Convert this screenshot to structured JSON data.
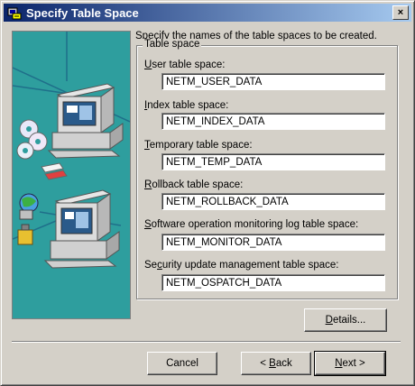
{
  "window": {
    "title": "Specify Table Space",
    "close_glyph": "×"
  },
  "intro": "Specify the names of the table spaces to be created.",
  "group": {
    "label": "Table space"
  },
  "fields": [
    {
      "label_pre": "",
      "label_key": "U",
      "label_post": "ser table space:",
      "value": "NETM_USER_DATA"
    },
    {
      "label_pre": "",
      "label_key": "I",
      "label_post": "ndex table space:",
      "value": "NETM_INDEX_DATA"
    },
    {
      "label_pre": "",
      "label_key": "T",
      "label_post": "emporary table space:",
      "value": "NETM_TEMP_DATA"
    },
    {
      "label_pre": "",
      "label_key": "R",
      "label_post": "ollback table space:",
      "value": "NETM_ROLLBACK_DATA"
    },
    {
      "label_pre": "",
      "label_key": "S",
      "label_post": "oftware operation monitoring log table space:",
      "value": "NETM_MONITOR_DATA"
    },
    {
      "label_pre": "Se",
      "label_key": "c",
      "label_post": "urity update management table space:",
      "value": "NETM_OSPATCH_DATA"
    }
  ],
  "buttons": {
    "details": {
      "pre": "",
      "key": "D",
      "post": "etails..."
    },
    "cancel": {
      "label": "Cancel"
    },
    "back": {
      "pre": "< ",
      "key": "B",
      "post": "ack"
    },
    "next": {
      "pre": "",
      "key": "N",
      "post": "ext >"
    }
  },
  "icons": {
    "app": "setup-icon",
    "illustration": "network-computers-illustration"
  }
}
